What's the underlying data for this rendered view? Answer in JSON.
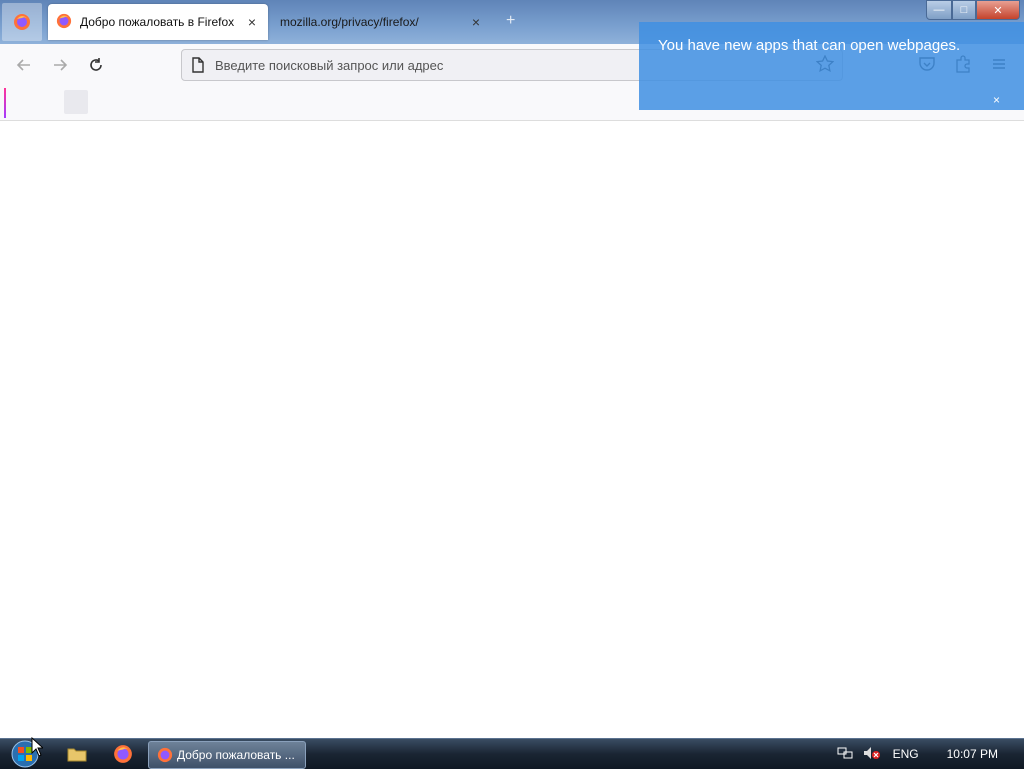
{
  "tabs": [
    {
      "label": "Добро пожаловать в Firefox",
      "close": "×"
    },
    {
      "label": "mozilla.org/privacy/firefox/",
      "close": "×"
    }
  ],
  "new_tab_label": "+",
  "window_controls": {
    "minimize": "—",
    "maximize": "□",
    "close": "✕"
  },
  "nav": {
    "back_icon": "arrow-left-icon",
    "forward_icon": "arrow-right-icon",
    "reload_icon": "reload-icon"
  },
  "urlbar": {
    "placeholder": "Введите поисковый запрос или адрес",
    "value": ""
  },
  "notification": {
    "text": "You have new apps that can open webpages.",
    "close": "×"
  },
  "taskbar": {
    "task_label": "Добро пожаловать ...",
    "lang": "ENG",
    "time": "10:07 PM"
  },
  "colors": {
    "notification_bg": "#3f8fe2",
    "taskbar_bg": "#1a2533",
    "accent": "#ff3399"
  }
}
